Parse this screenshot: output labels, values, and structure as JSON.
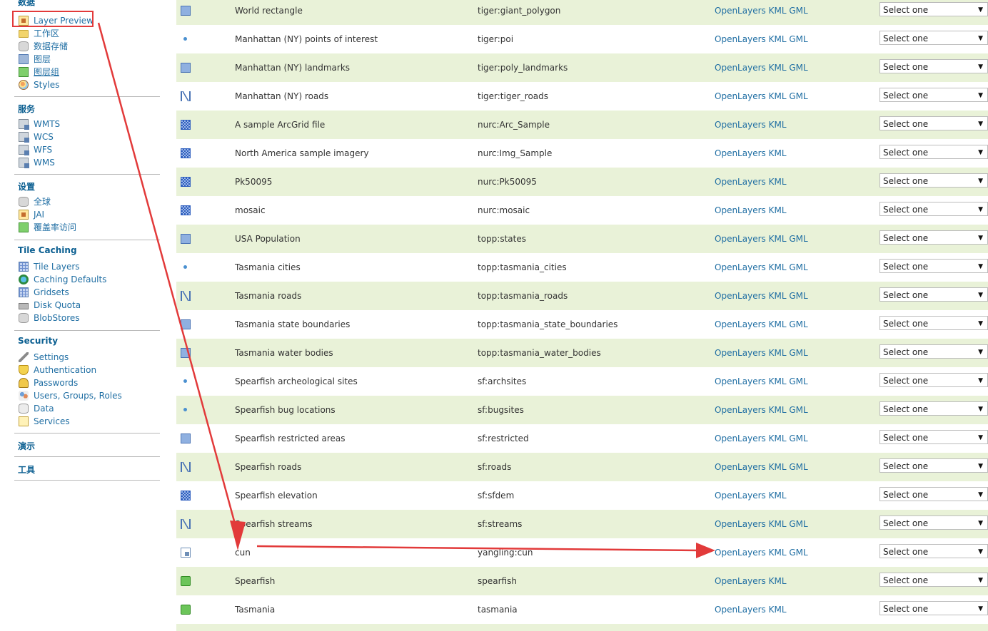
{
  "sidebar": {
    "cut_heading": "数据",
    "data_items": [
      {
        "label": "Layer Preview",
        "icon": "layer-preview-icon"
      },
      {
        "label": "工作区",
        "icon": "folder-icon"
      },
      {
        "label": "数据存储",
        "icon": "database-icon"
      },
      {
        "label": "图层",
        "icon": "layer-icon"
      },
      {
        "label": "图层组",
        "icon": "layer-group-icon"
      },
      {
        "label": "Styles",
        "icon": "styles-icon"
      }
    ],
    "services_heading": "服务",
    "services_items": [
      {
        "label": "WMTS"
      },
      {
        "label": "WCS"
      },
      {
        "label": "WFS"
      },
      {
        "label": "WMS"
      }
    ],
    "settings_heading": "设置",
    "settings_items": [
      {
        "label": "全球"
      },
      {
        "label": "JAI"
      },
      {
        "label": "覆盖率访问"
      }
    ],
    "tile_heading": "Tile Caching",
    "tile_items": [
      {
        "label": "Tile Layers"
      },
      {
        "label": "Caching Defaults"
      },
      {
        "label": "Gridsets"
      },
      {
        "label": "Disk Quota"
      },
      {
        "label": "BlobStores"
      }
    ],
    "security_heading": "Security",
    "security_items": [
      {
        "label": "Settings"
      },
      {
        "label": "Authentication"
      },
      {
        "label": "Passwords"
      },
      {
        "label": "Users, Groups, Roles"
      },
      {
        "label": "Data"
      },
      {
        "label": "Services"
      }
    ],
    "demo_heading": "演示",
    "tools_heading": "工具"
  },
  "table": {
    "rows": [
      {
        "type": "polygon",
        "title": "World rectangle",
        "name": "tiger:giant_polygon",
        "links": [
          "OpenLayers",
          "KML",
          "GML"
        ],
        "select": "Select one"
      },
      {
        "type": "point",
        "title": "Manhattan (NY) points of interest",
        "name": "tiger:poi",
        "links": [
          "OpenLayers",
          "KML",
          "GML"
        ],
        "select": "Select one"
      },
      {
        "type": "polygon",
        "title": "Manhattan (NY) landmarks",
        "name": "tiger:poly_landmarks",
        "links": [
          "OpenLayers",
          "KML",
          "GML"
        ],
        "select": "Select one"
      },
      {
        "type": "line",
        "title": "Manhattan (NY) roads",
        "name": "tiger:tiger_roads",
        "links": [
          "OpenLayers",
          "KML",
          "GML"
        ],
        "select": "Select one"
      },
      {
        "type": "raster",
        "title": "A sample ArcGrid file",
        "name": "nurc:Arc_Sample",
        "links": [
          "OpenLayers",
          "KML"
        ],
        "select": "Select one"
      },
      {
        "type": "raster",
        "title": "North America sample imagery",
        "name": "nurc:Img_Sample",
        "links": [
          "OpenLayers",
          "KML"
        ],
        "select": "Select one"
      },
      {
        "type": "raster",
        "title": "Pk50095",
        "name": "nurc:Pk50095",
        "links": [
          "OpenLayers",
          "KML"
        ],
        "select": "Select one"
      },
      {
        "type": "raster",
        "title": "mosaic",
        "name": "nurc:mosaic",
        "links": [
          "OpenLayers",
          "KML"
        ],
        "select": "Select one"
      },
      {
        "type": "polygon",
        "title": "USA Population",
        "name": "topp:states",
        "links": [
          "OpenLayers",
          "KML",
          "GML"
        ],
        "select": "Select one"
      },
      {
        "type": "point",
        "title": "Tasmania cities",
        "name": "topp:tasmania_cities",
        "links": [
          "OpenLayers",
          "KML",
          "GML"
        ],
        "select": "Select one"
      },
      {
        "type": "line",
        "title": "Tasmania roads",
        "name": "topp:tasmania_roads",
        "links": [
          "OpenLayers",
          "KML",
          "GML"
        ],
        "select": "Select one"
      },
      {
        "type": "polygon",
        "title": "Tasmania state boundaries",
        "name": "topp:tasmania_state_boundaries",
        "links": [
          "OpenLayers",
          "KML",
          "GML"
        ],
        "select": "Select one"
      },
      {
        "type": "polygon",
        "title": "Tasmania water bodies",
        "name": "topp:tasmania_water_bodies",
        "links": [
          "OpenLayers",
          "KML",
          "GML"
        ],
        "select": "Select one"
      },
      {
        "type": "point",
        "title": "Spearfish archeological sites",
        "name": "sf:archsites",
        "links": [
          "OpenLayers",
          "KML",
          "GML"
        ],
        "select": "Select one"
      },
      {
        "type": "point",
        "title": "Spearfish bug locations",
        "name": "sf:bugsites",
        "links": [
          "OpenLayers",
          "KML",
          "GML"
        ],
        "select": "Select one"
      },
      {
        "type": "polygon",
        "title": "Spearfish restricted areas",
        "name": "sf:restricted",
        "links": [
          "OpenLayers",
          "KML",
          "GML"
        ],
        "select": "Select one"
      },
      {
        "type": "line",
        "title": "Spearfish roads",
        "name": "sf:roads",
        "links": [
          "OpenLayers",
          "KML",
          "GML"
        ],
        "select": "Select one"
      },
      {
        "type": "raster",
        "title": "Spearfish elevation",
        "name": "sf:sfdem",
        "links": [
          "OpenLayers",
          "KML"
        ],
        "select": "Select one"
      },
      {
        "type": "line",
        "title": "Spearfish streams",
        "name": "sf:streams",
        "links": [
          "OpenLayers",
          "KML",
          "GML"
        ],
        "select": "Select one"
      },
      {
        "type": "generic",
        "title": "cun",
        "name": "yangling:cun",
        "links": [
          "OpenLayers",
          "KML",
          "GML"
        ],
        "select": "Select one"
      },
      {
        "type": "group",
        "title": "Spearfish",
        "name": "spearfish",
        "links": [
          "OpenLayers",
          "KML"
        ],
        "select": "Select one"
      },
      {
        "type": "group",
        "title": "Tasmania",
        "name": "tasmania",
        "links": [
          "OpenLayers",
          "KML"
        ],
        "select": "Select one"
      }
    ]
  },
  "colors": {
    "row_highlight": "#e9f2d8",
    "link": "#1f6ea3",
    "heading": "#0b5f91",
    "annotation": "#e23a3a"
  }
}
